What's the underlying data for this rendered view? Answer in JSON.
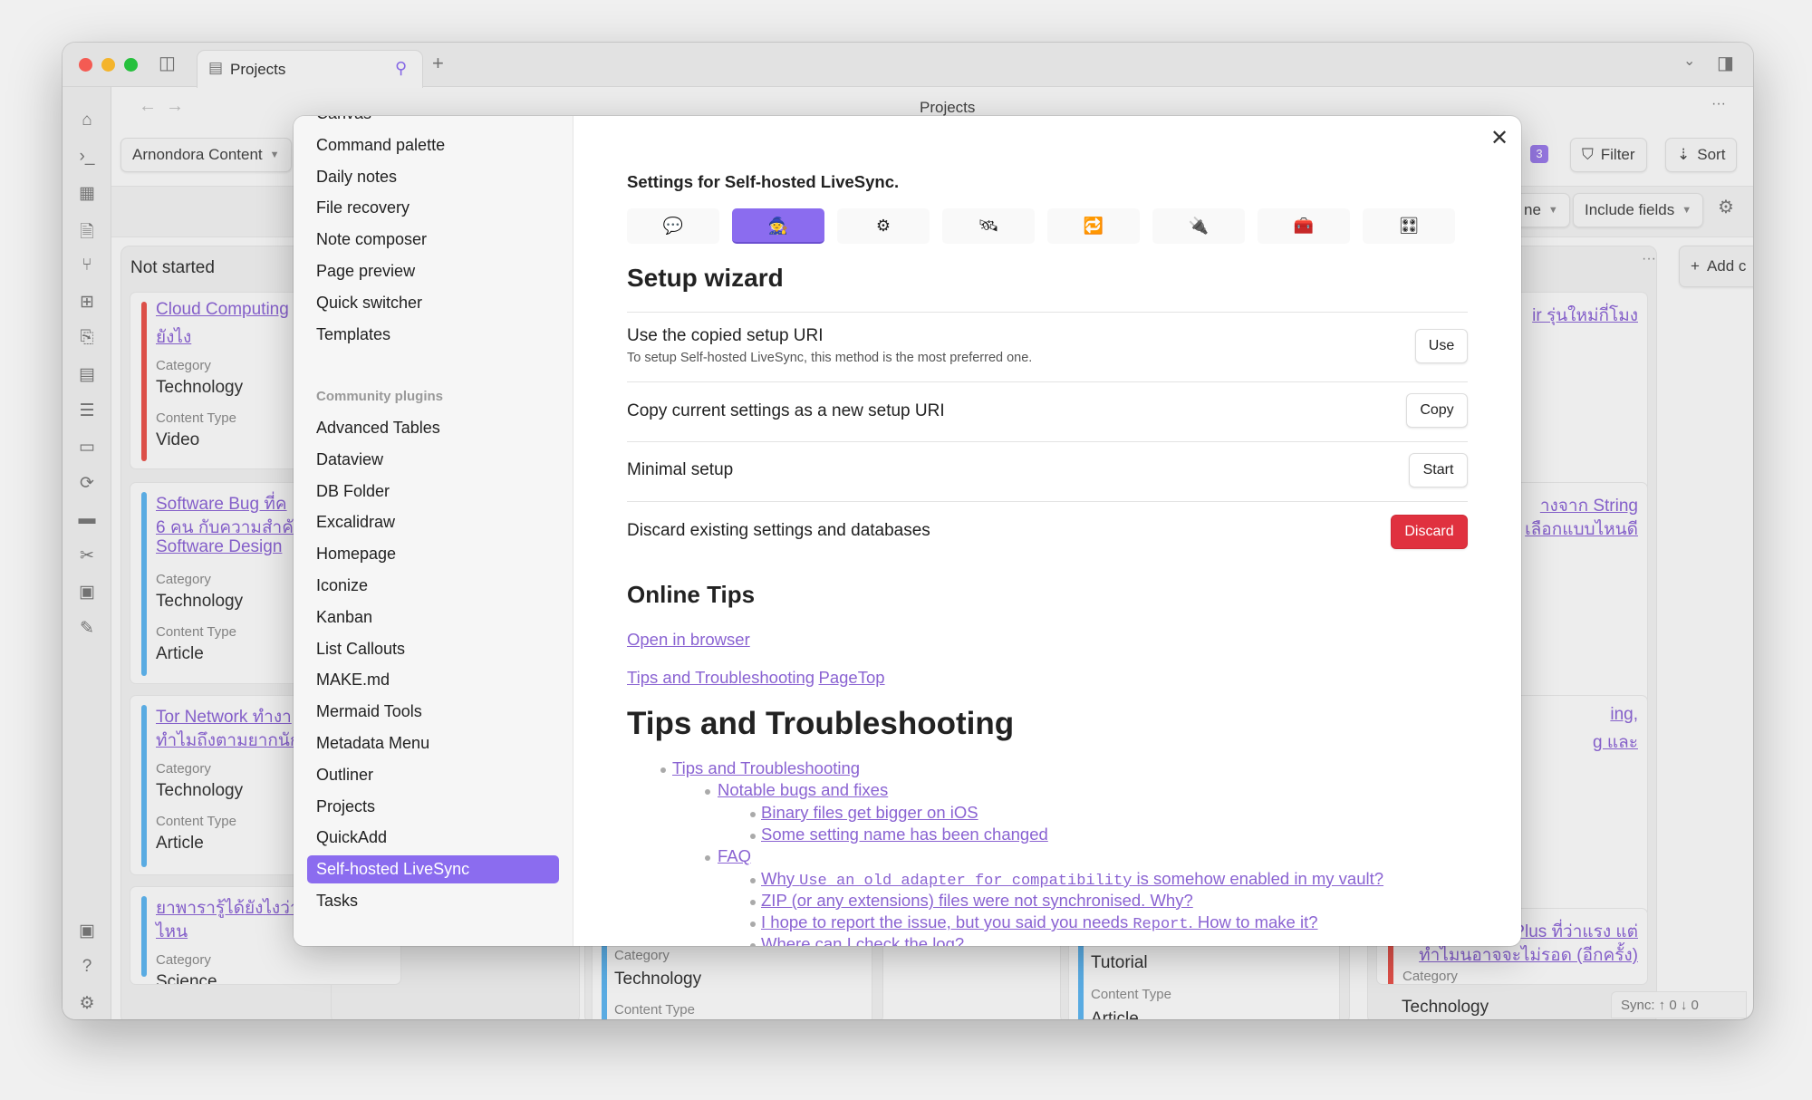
{
  "window": {
    "tab_title": "Projects",
    "nav_title": "Projects",
    "colors": {
      "accent": "#8b6cef",
      "danger": "#e0313f",
      "link": "#8a63d2"
    }
  },
  "ribbon_icons": [
    "home-icon",
    "terminal-icon",
    "calendar-icon",
    "file-search-icon",
    "graph-icon",
    "dashboard-icon",
    "copy-icon",
    "table-icon",
    "list-icon",
    "layout-icon",
    "sync-icon",
    "archive-icon",
    "tools-icon",
    "kanban-icon",
    "excalidraw-icon"
  ],
  "ribbon_bottom_icons": [
    "vault-icon",
    "help-icon",
    "settings-icon"
  ],
  "toolbar": {
    "project": "Arnondora Content",
    "badge": "3",
    "filter": "Filter",
    "sort": "Sort",
    "partial_select": "ne",
    "include_fields": "Include fields"
  },
  "board": {
    "column1": {
      "title": "Not started",
      "cards": [
        {
          "title": [
            "Cloud Computing",
            "ยังไง"
          ],
          "category_label": "Category",
          "category": "Technology",
          "type_label": "Content Type",
          "type": "Video",
          "color": "#e5534b"
        },
        {
          "title": [
            "Software Bug ที่ค",
            "6 คน กับความสำคั",
            "Software Design"
          ],
          "category_label": "Category",
          "category": "Technology",
          "type_label": "Content Type",
          "type": "Article",
          "color": "#5db2ec"
        },
        {
          "title": [
            "Tor Network ทำงา",
            "ทำไมถึงตามยากนัก"
          ],
          "category_label": "Category",
          "category": "Technology",
          "type_label": "Content Type",
          "type": "Article",
          "color": "#5db2ec"
        },
        {
          "title": [
            "ยาพารารู้ได้ยังไงว่า",
            "ไหน"
          ],
          "category_label": "Category",
          "category": "Science",
          "type_label": "Content Type",
          "type": "",
          "color": "#5db2ec"
        }
      ]
    },
    "column3_partial": {
      "category_label": "Category",
      "category": "Technology",
      "type_label": "Content Type"
    },
    "column4_partial": {
      "type": "Tutorial",
      "type_label": "Content Type",
      "type2": "Article"
    },
    "column5_titles": [
      [
        "ir รุ่นใหม่กี่โมง"
      ],
      [
        "างจาก String",
        "เลือกแบบไหนดี"
      ],
      [
        "ing,",
        "g และ"
      ],
      [
        "Plus ที่ว่าแรง แต่",
        "ทำไมนอาจจะไม่รอด (อีกครั้ง)"
      ]
    ],
    "column5_last": {
      "category_label": "Category",
      "category": "Technology"
    },
    "add_column": "Add c",
    "status": "Sync: ↑ 0 ↓ 0"
  },
  "settings": {
    "sidebar_top": [
      "Canvas",
      "Command palette",
      "Daily notes",
      "File recovery",
      "Note composer",
      "Page preview",
      "Quick switcher",
      "Templates"
    ],
    "community_heading": "Community plugins",
    "community": [
      "Advanced Tables",
      "Dataview",
      "DB Folder",
      "Excalidraw",
      "Homepage",
      "Iconize",
      "Kanban",
      "List Callouts",
      "MAKE.md",
      "Mermaid Tools",
      "Metadata Menu",
      "Outliner",
      "Projects",
      "QuickAdd",
      "Self-hosted LiveSync",
      "Tasks"
    ],
    "selected": "Self-hosted LiveSync",
    "title": "Settings for Self-hosted LiveSync.",
    "tabs": [
      {
        "icon": "💬",
        "name": "chat-icon"
      },
      {
        "icon": "🧙",
        "name": "wizard-icon"
      },
      {
        "icon": "⚙",
        "name": "gear-icon"
      },
      {
        "icon": "🛰",
        "name": "satellite-icon"
      },
      {
        "icon": "🔁",
        "name": "repeat-icon"
      },
      {
        "icon": "🔌",
        "name": "plug-icon"
      },
      {
        "icon": "🧰",
        "name": "toolbox-icon"
      },
      {
        "icon": "🎛",
        "name": "control-knobs-icon"
      }
    ],
    "selected_tab": 1,
    "setup_heading": "Setup wizard",
    "rows": [
      {
        "name": "Use the copied setup URI",
        "desc": "To setup Self-hosted LiveSync, this method is the most preferred one.",
        "button": "Use"
      },
      {
        "name": "Copy current settings as a new setup URI",
        "button": "Copy"
      },
      {
        "name": "Minimal setup",
        "button": "Start"
      },
      {
        "name": "Discard existing settings and databases",
        "button": "Discard"
      }
    ],
    "online_heading": "Online Tips",
    "open_browser": "Open in browser",
    "tips_link": "Tips and Troubleshooting",
    "pagetop_link": "PageTop",
    "tips_heading": "Tips and Troubleshooting",
    "toc": [
      {
        "level": 0,
        "text": "Tips and Troubleshooting"
      },
      {
        "level": 1,
        "text": "Notable bugs and fixes"
      },
      {
        "level": 2,
        "text": "Binary files get bigger on iOS"
      },
      {
        "level": 2,
        "text": "Some setting name has been changed"
      },
      {
        "level": 1,
        "text": "FAQ"
      },
      {
        "level": 2,
        "pre": "Why ",
        "code": "Use an old adapter for compatibility",
        "post": " is somehow enabled in my vault?"
      },
      {
        "level": 2,
        "text": "ZIP (or any extensions) files were not synchronised. Why?"
      },
      {
        "level": 2,
        "pre": "I hope to report the issue, but you said you needs ",
        "code": "Report",
        "post": ". How to make it?"
      },
      {
        "level": 2,
        "text": "Where can I check the log?"
      }
    ]
  }
}
